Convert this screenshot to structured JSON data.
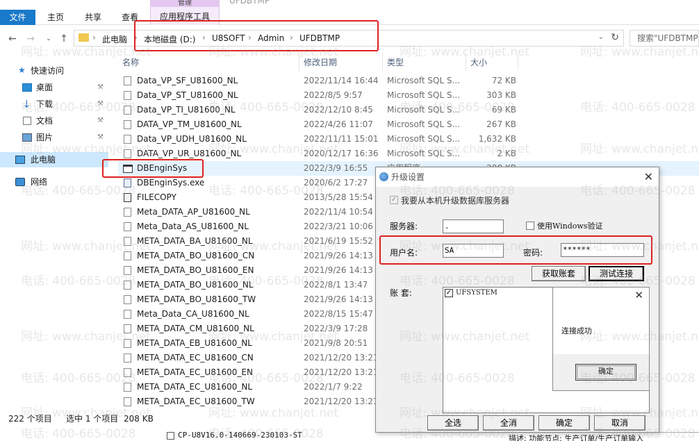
{
  "ribbon": {
    "file_tab": "文件",
    "tabs": [
      "主页",
      "共享",
      "查看"
    ],
    "context_group": "管理",
    "context_tab": "应用程序工具",
    "window_title_fragment": "UFDBTMP"
  },
  "navigation": {
    "back_icon": "arrow-left-icon",
    "forward_icon": "arrow-right-icon",
    "recent_icon": "chevron-down-icon",
    "up_icon": "arrow-up-icon",
    "breadcrumb": [
      "此电脑",
      "本地磁盘 (D:)",
      "U8SOFT",
      "Admin",
      "UFDBTMP"
    ],
    "search_placeholder": "搜索\"UFDBTMP\""
  },
  "sidebar": {
    "items": [
      {
        "label": "快速访问",
        "icon": "star-icon"
      },
      {
        "label": "桌面",
        "icon": "desktop-icon",
        "pinned": true
      },
      {
        "label": "下载",
        "icon": "download-icon",
        "pinned": true
      },
      {
        "label": "文档",
        "icon": "document-icon",
        "pinned": true
      },
      {
        "label": "图片",
        "icon": "picture-icon",
        "pinned": true
      },
      {
        "label": "此电脑",
        "icon": "computer-icon",
        "selected": true
      },
      {
        "label": "网络",
        "icon": "network-icon"
      }
    ]
  },
  "filelist": {
    "columns": {
      "name": "名称",
      "date": "修改日期",
      "type": "类型",
      "size": "大小"
    },
    "rows": [
      {
        "name": "Data_VP_SF_U81600_NL",
        "date": "2022/11/14 16:44",
        "type": "Microsoft SQL S...",
        "size": "72 KB"
      },
      {
        "name": "Data_VP_ST_U81600_NL",
        "date": "2022/8/5 9:57",
        "type": "Microsoft SQL S...",
        "size": "303 KB"
      },
      {
        "name": "Data_VP_TI_U81600_NL",
        "date": "2022/12/10 8:45",
        "type": "Microsoft SQL S...",
        "size": "69 KB"
      },
      {
        "name": "DATA_VP_TM_U81600_NL",
        "date": "2022/4/26 11:07",
        "type": "Microsoft SQL S...",
        "size": "267 KB"
      },
      {
        "name": "Data_VP_UDH_U81600_NL",
        "date": "2022/11/11 15:01",
        "type": "Microsoft SQL S...",
        "size": "1,632 KB"
      },
      {
        "name": "DATA_VP_UR_U81600_NL",
        "date": "2020/12/17 16:36",
        "type": "Microsoft SQL S...",
        "size": "2 KB"
      },
      {
        "name": "DBEnginSys",
        "date": "2022/3/9 16:55",
        "type": "应用程序",
        "size": "208 KB",
        "selected": true,
        "kind": "app"
      },
      {
        "name": "DBEnginSys.exe",
        "date": "2020/6/2 17:27",
        "type": "",
        "size": "",
        "kind": "exe"
      },
      {
        "name": "FILECOPY",
        "date": "2013/5/28 15:54",
        "type": "",
        "size": "",
        "kind": "copy"
      },
      {
        "name": "Meta_DATA_AP_U81600_NL",
        "date": "2022/11/4 10:54",
        "type": "",
        "size": ""
      },
      {
        "name": "Meta_Data_AS_U81600_NL",
        "date": "2022/3/21 10:06",
        "type": "",
        "size": ""
      },
      {
        "name": "META_DATA_BA_U81600_NL",
        "date": "2021/6/19 15:52",
        "type": "",
        "size": ""
      },
      {
        "name": "META_DATA_BO_U81600_CN",
        "date": "2021/9/26 14:13",
        "type": "",
        "size": ""
      },
      {
        "name": "META_DATA_BO_U81600_EN",
        "date": "2021/9/26 14:13",
        "type": "",
        "size": ""
      },
      {
        "name": "META_DATA_BO_U81600_NL",
        "date": "2022/8/1 13:47",
        "type": "",
        "size": ""
      },
      {
        "name": "META_DATA_BO_U81600_TW",
        "date": "2021/9/26 14:13",
        "type": "",
        "size": ""
      },
      {
        "name": "Meta_Data_CA_U81600_NL",
        "date": "2022/8/15 15:47",
        "type": "",
        "size": ""
      },
      {
        "name": "META_DATA_CM_U81600_NL",
        "date": "2022/3/9 17:28",
        "type": "",
        "size": ""
      },
      {
        "name": "META_DATA_EB_U81600_NL",
        "date": "2021/9/8 20:51",
        "type": "",
        "size": ""
      },
      {
        "name": "META_DATA_EC_U81600_CN",
        "date": "2021/12/20 13:21",
        "type": "",
        "size": ""
      },
      {
        "name": "META_DATA_EC_U81600_EN",
        "date": "2021/12/20 13:21",
        "type": "",
        "size": ""
      },
      {
        "name": "META_DATA_EC_U81600_NL",
        "date": "2022/1/7 9:22",
        "type": "",
        "size": ""
      },
      {
        "name": "META_DATA_EC_U81600_TW",
        "date": "2021/12/20 13:21",
        "type": "",
        "size": ""
      }
    ]
  },
  "statusbar": {
    "count": "222 个项目",
    "selected": "选中 1 个项目",
    "size": "208 KB"
  },
  "dialog": {
    "title": "升级设置",
    "local_upgrade_label": "我要从本机升级数据库服务器",
    "server_label": "服务器:",
    "server_value": ".",
    "windows_auth_label": "使用Windows验证",
    "username_label": "用户名:",
    "username_value": "SA",
    "password_label": "密码:",
    "password_value": "******",
    "get_accounts_button": "获取账套",
    "test_connection_button": "测试连接",
    "accounts_label": "账    套:",
    "accounts": [
      {
        "name": "UFSYSTEM",
        "checked": true
      }
    ],
    "select_all_button": "全选",
    "deselect_all_button": "全消",
    "ok_button": "确定",
    "cancel_button": "取消"
  },
  "messagebox": {
    "message": "连接成功",
    "ok_button": "确定"
  },
  "background_window": {
    "list_item": "CP-U8V16.0-140669-230103-ST",
    "text": "描述: 功能节点: 生产订单/生产订单输入"
  },
  "watermark": {
    "phone": "电话: 400-665-0028",
    "site": "网址: www.chanjet.net"
  }
}
